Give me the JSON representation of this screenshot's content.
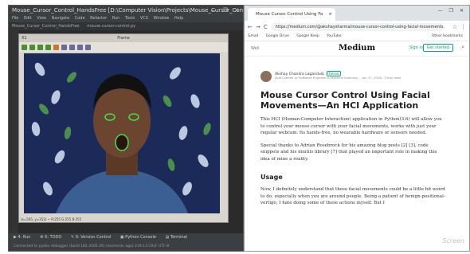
{
  "ide": {
    "title": "Mouse_Cursor_Control_HandsFree  [D:\\Computer Vision\\Projects\\Mouse_Cursor_Control_Han...",
    "window_controls": "— ❐ ✕",
    "menu": [
      "File",
      "Edit",
      "View",
      "Navigate",
      "Code",
      "Refactor",
      "Run",
      "Tools",
      "VCS",
      "Window",
      "Help"
    ],
    "tabs": [
      "Mouse_Cursor_Control_HandsFree",
      "mouse-cursor-control.py"
    ],
    "frame_window": {
      "title": "Frame",
      "close": "X1",
      "status": "(x=565, y=353) ~ R:255 G:255 B:255"
    },
    "bottom_tabs": [
      "▶ 4: Run",
      "⚙ 6: TODO",
      "✎ 9: Version Control",
      "▣ Python Console",
      "▤ Terminal"
    ],
    "status_bar": "Connected to pydev debugger (build 182.4505.26) (moments ago)   219:13   CRLF   UTF-8"
  },
  "browser": {
    "tab_title": "Mouse Cursor Control Using Fa",
    "tab_close": "×",
    "window_controls": "— ❐ ✕",
    "url": "https://medium.com/@akshaysharma/mouse-cursor-control-using-facial-movements...",
    "bookmarks": [
      "Gmail",
      "Google Drive",
      "Google Keep",
      "YouTube",
      "Other bookmarks"
    ],
    "nav": {
      "back": "←",
      "forward": "→",
      "reload": "C",
      "star": "☆",
      "menu": "⋮"
    }
  },
  "medium": {
    "left_text": "Well",
    "logo": "Medium",
    "sign_in": "Sign in",
    "get_started": "Get started",
    "search_icon": "⌕"
  },
  "article": {
    "author": "Akshay Chandra Lagandula",
    "follow": "Follow",
    "author_sub": "Avid Learner of Software Engineer & Machine Learning ... Jun 17, 2018 · 5 min read",
    "title": "Mouse Cursor Control Using Facial Movements—An HCI Application",
    "para1": "This HCI (Human-Computer Interaction) application in Python(3.6) will allow you to control your mouse cursor with your facial movements, works with just your regular webcam. Its hands-free, no wearable hardware or sensors needed.",
    "para2": "Special thanks to Adrian Rosebrock for his amazing blog posts [2] [3], code snippets and his imutils library [7] that played an important role in making this idea of mine a reality.",
    "usage_heading": "Usage",
    "para3": "Now, I definitely understand that these facial movements could be a little bit weird to do, especially when you are around people. Being a patient of benign-positional-vertigo, I hate doing some of these actions myself. But I",
    "watermark": "Screen"
  },
  "colors": {
    "accent_green": "#03a87c",
    "ide_dark": "#2b2b2b",
    "video_blue": "#1c2a5a"
  }
}
